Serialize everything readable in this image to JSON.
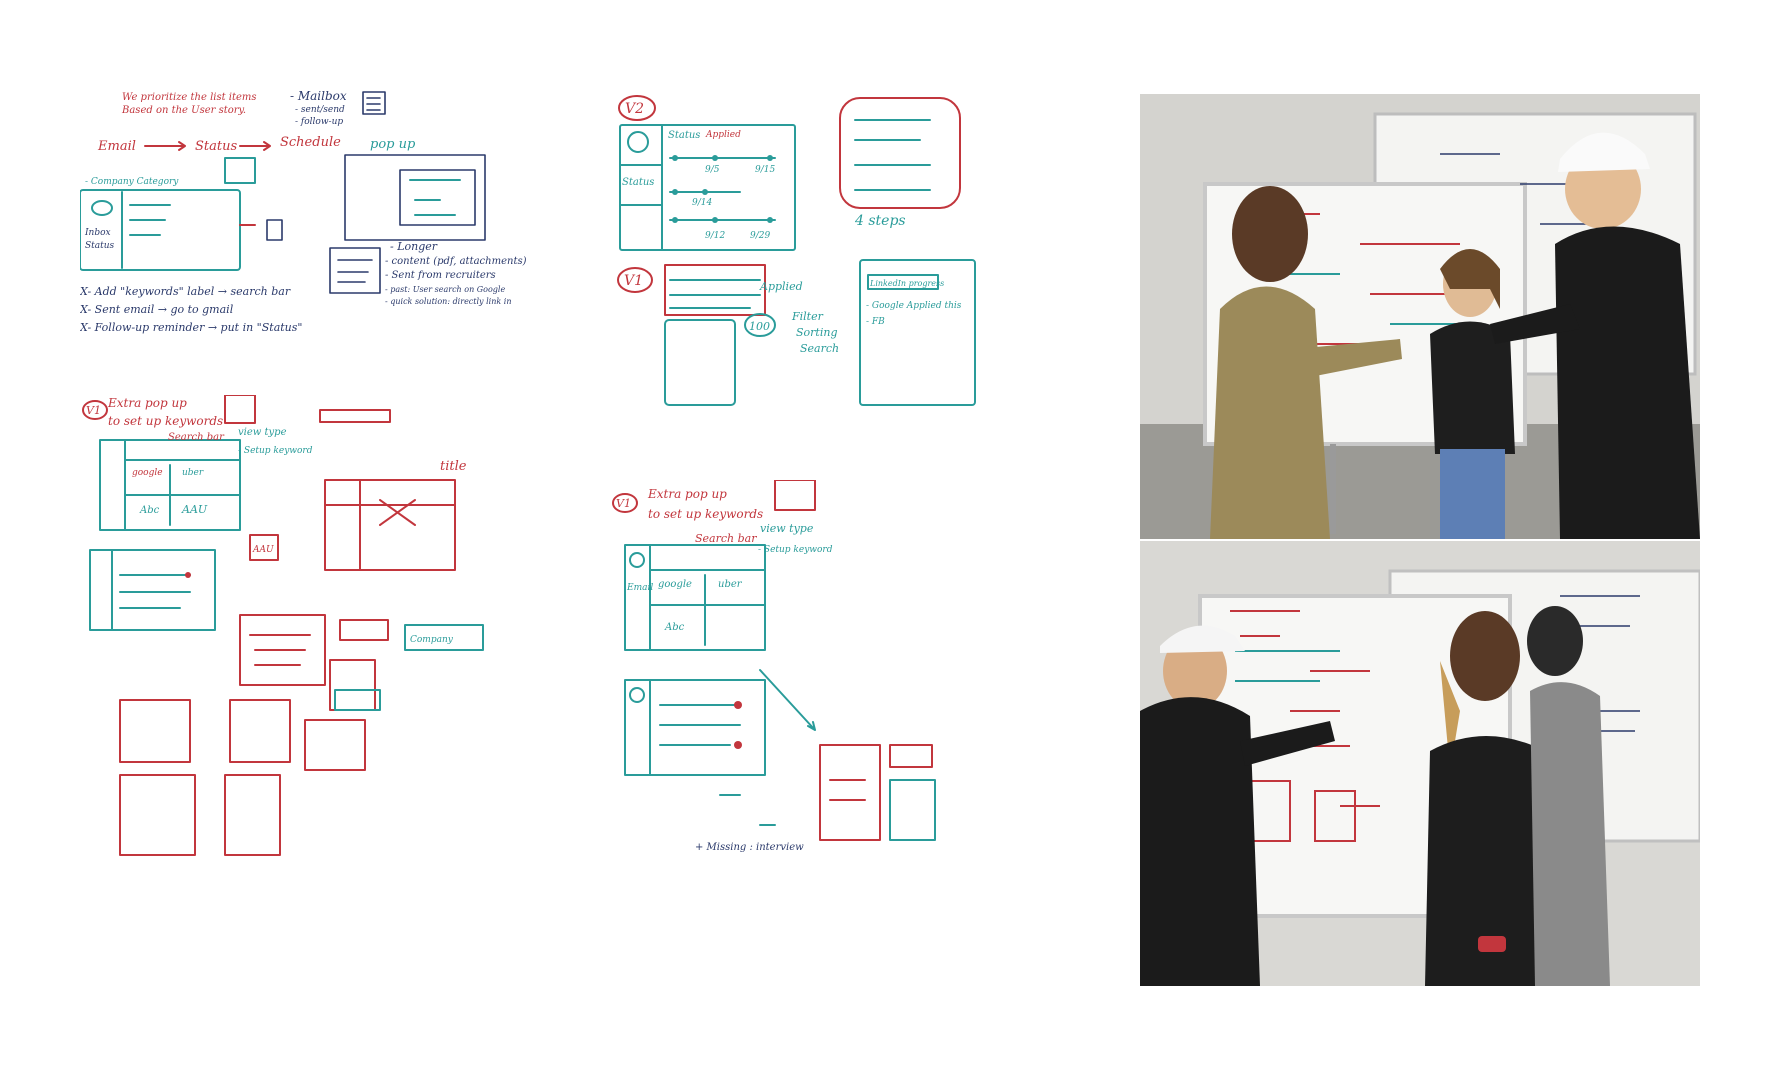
{
  "sketch1": {
    "note_top": "We prioritize the list items",
    "note_top2": "Based on the User story.",
    "flow_email": "Email",
    "flow_status": "Status",
    "flow_schedule": "Schedule",
    "company_category": "- Company Category",
    "mailbox": "- Mailbox",
    "mailbox_sent": "- sent/send",
    "mailbox_follow": "- follow-up",
    "popup": "pop up",
    "longer": "- Longer",
    "content": "- content (pdf, attachments)",
    "sent_from": "- Sent from recruiters",
    "past": "- past: User search on Google",
    "quick": "- quick solution: directly link in",
    "x_add": "X- Add \"keywords\" label → search bar",
    "x_sent": "X- Sent email → go to gmail",
    "x_follow": "X- Follow-up reminder → put in \"Status\""
  },
  "sketch2": {
    "v2": "V2",
    "status": "Status",
    "applied": "Applied",
    "dates": [
      "9/5",
      "9/12",
      "9/15",
      "9/14",
      "9/12",
      "9/29"
    ],
    "v1": "V1",
    "applied2": "Applied",
    "filter": "Filter",
    "sorting": "Sorting",
    "search": "Search",
    "hundred": "100",
    "four_steps": "4 steps",
    "google_applied": "- Google Applied this",
    "fb": "- FB",
    "airbnb": "LinkedIn progress"
  },
  "sketch3": {
    "v1": "V1",
    "extra": "Extra pop up",
    "setup": "to set up keywords",
    "search_bar": "Search bar",
    "view_type": "view type",
    "setup_keyword": "- Setup keyword",
    "google": "google",
    "uber": "uber",
    "abc": "Abc",
    "aau": "AAU",
    "title": "title",
    "company": "Company"
  },
  "sketch4": {
    "v1": "V1",
    "extra": "Extra pop up",
    "setup": "to set up keywords",
    "search_bar": "Search bar",
    "view_type": "view type",
    "setup_keyword": "- Setup keyword",
    "google": "google",
    "uber": "uber",
    "abc": "Abc",
    "email": "Email",
    "missing": "+ Missing : interview"
  },
  "photos": {
    "top": "whiteboard-session-photo",
    "bottom": "whiteboard-session-photo"
  }
}
